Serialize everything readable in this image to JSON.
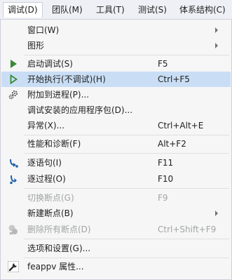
{
  "menubar": {
    "items": [
      {
        "label": "调试(D)"
      },
      {
        "label": "团队(M)"
      },
      {
        "label": "工具(T)"
      },
      {
        "label": "测试(S)"
      },
      {
        "label": "体系结构(C)"
      }
    ]
  },
  "menu": {
    "items": [
      {
        "label": "窗口(W)",
        "shortcut": "",
        "submenu": true
      },
      {
        "label": "图形",
        "shortcut": "",
        "submenu": true
      },
      {
        "label": "启动调试(S)",
        "shortcut": "F5",
        "icon": "start-debugging-icon"
      },
      {
        "label": "开始执行(不调试)(H)",
        "shortcut": "Ctrl+F5",
        "icon": "start-without-debugging-icon"
      },
      {
        "label": "附加到进程(P)...",
        "shortcut": "",
        "icon": "attach-process-icon"
      },
      {
        "label": "调试安装的应用程序包(D)...",
        "shortcut": ""
      },
      {
        "label": "异常(X)...",
        "shortcut": "Ctrl+Alt+E"
      },
      {
        "label": "性能和诊断(F)",
        "shortcut": "Alt+F2"
      },
      {
        "label": "逐语句(I)",
        "shortcut": "F11",
        "icon": "step-into-icon"
      },
      {
        "label": "逐过程(O)",
        "shortcut": "F10",
        "icon": "step-over-icon"
      },
      {
        "label": "切换断点(G)",
        "shortcut": "F9",
        "disabled": true
      },
      {
        "label": "新建断点(B)",
        "shortcut": "",
        "submenu": true
      },
      {
        "label": "删除所有断点(D)",
        "shortcut": "Ctrl+Shift+F9",
        "disabled": true,
        "icon": "delete-breakpoints-icon"
      },
      {
        "label": "选项和设置(G)...",
        "shortcut": ""
      },
      {
        "label": "feappv 属性...",
        "shortcut": "",
        "icon": "wrench-icon"
      }
    ]
  },
  "colors": {
    "hover": "#c9def5",
    "play_green": "#388a34",
    "step_blue": "#1e5fa8",
    "disabled_text": "#a2a4a5"
  }
}
